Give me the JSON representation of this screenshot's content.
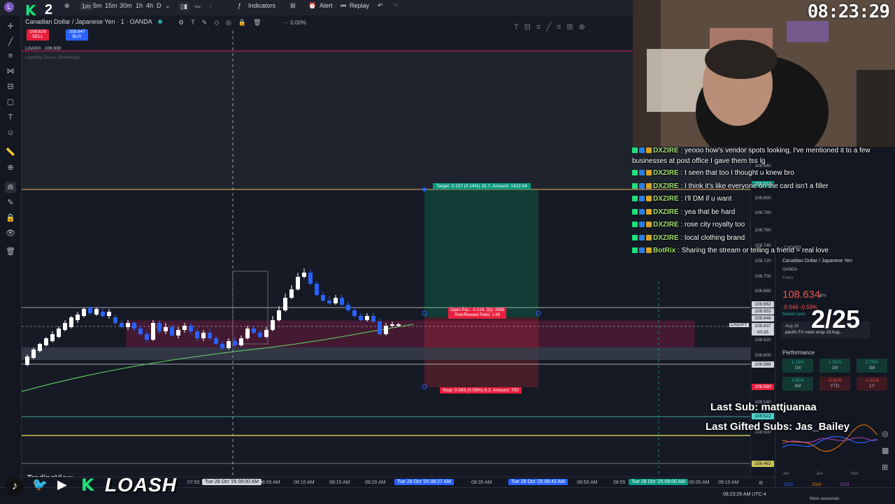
{
  "toolbar": {
    "timeframes": [
      "1m",
      "5m",
      "15m",
      "30m",
      "1h",
      "4h",
      "D"
    ],
    "active_timeframe": "1m",
    "indicators_label": "Indicators",
    "alert_label": "Alert",
    "replay_label": "Replay"
  },
  "symbol": {
    "name": "Canadian Dollar / Japanese Yen · 1 · OANDA",
    "change_pct": "0.00%",
    "sell_price": "108.629",
    "sell_label": "SELL",
    "buy_price": "108.647",
    "buy_label": "BUY",
    "loash_label": "LOASH · 108.630",
    "indicator_label": "Liquidity Zones (Sinbeluga)"
  },
  "position": {
    "target_label": "Target: 0.157 (0.14%) 15.7, Amount: 1422.04",
    "open_label": "Open P&L: -0.016, Qty: 2688",
    "rr_label": "Risk/Reward Ratio: 1.69",
    "stop_label": "Stop: 0.093 (0.09%) 9.3, Amount: 750"
  },
  "price_axis": {
    "labels": [
      "108.840",
      "108.800",
      "108.780",
      "108.760",
      "108.740",
      "108.720",
      "108.700",
      "108.680",
      "108.660",
      "108.620",
      "108.600",
      "108.580",
      "108.540",
      "108.520",
      "108.500",
      "108.480"
    ],
    "tags": {
      "top": "108.812",
      "current_a": "108.662",
      "current_b": "108.653",
      "current_c": "108.648",
      "symbol": "CADJPY",
      "last": "108.637",
      "countdown": "00:35",
      "low": "108.588",
      "stop": "108.560",
      "bottom_line": "108.522",
      "yellow": "108.462"
    }
  },
  "time_axis": {
    "labels": [
      "07:55",
      "08:05 AM",
      "08:10 AM",
      "08:15 AM",
      "08:20 AM",
      "08:35 AM",
      "08:50 AM",
      "08:55",
      "09:05 AM",
      "09:10 AM"
    ],
    "tag_a": "Tue 28 Oct '25 08:00 AM",
    "tag_b": "Tue 28 Oct '25 08:27 AM",
    "tag_c": "Tue 28 Oct '25 08:43 AM",
    "tag_d": "Tue 28 Oct '25 09:00 AM",
    "status": "08:23:26 AM UTC-4",
    "watermark": "TradingView"
  },
  "stream": {
    "clock": "08:23:29",
    "counter": "2/25",
    "last_sub": "Last Sub: mattjuanaa",
    "last_gifted": "Last Gifted Subs: Jas_Bailey",
    "brand": "LOASH",
    "k2": "2"
  },
  "chat": [
    {
      "user": "DXZIRE",
      "text": " : yeooo how's vendor spots looking, I've mentioned it to a few businesses at post office I gave them tss lg"
    },
    {
      "user": "DXZIRE",
      "text": " : I seen that too I thought u knew bro"
    },
    {
      "user": "DXZIRE",
      "text": " : I think it's like everyone on the card isn't a filler"
    },
    {
      "user": "DXZIRE",
      "text": " : I'll DM if u want"
    },
    {
      "user": "DXZIRE",
      "text": " : yea that be hard"
    },
    {
      "user": "DXZIRE",
      "text": " : rose city royalty too"
    },
    {
      "user": "DXZIRE",
      "text": " : local clothing brand"
    },
    {
      "user": "BotRix",
      "text": " : Sharing the stream or telling a friend = real love"
    }
  ],
  "panel": {
    "symbol_code": "CADJPY",
    "title": "Canadian Dollar / Japanese Yen",
    "exchange": "OANDA",
    "type": "Forex",
    "price": "108.634",
    "currency": "JPY",
    "change": "-0.646  -0.59%",
    "market": "Market open",
    "news_date": "Aug 18",
    "news_text": "pacific FX news wrap 19 Aug...",
    "performance_label": "Performance",
    "perf": [
      {
        "v": "1.19%",
        "p": "1W",
        "c": "#26a69a"
      },
      {
        "v": "1.01%",
        "p": "1M",
        "c": "#26a69a"
      },
      {
        "v": "0.75%",
        "p": "3M",
        "c": "#26a69a"
      },
      {
        "v": "4.80%",
        "p": "6M",
        "c": "#26a69a"
      },
      {
        "v": "-0.62%",
        "p": "YTD",
        "c": "#ef5350"
      },
      {
        "v": "-1.51%",
        "p": "1Y",
        "c": "#ef5350"
      }
    ],
    "seasonals_x": [
      "Jan",
      "Jun",
      "Nov"
    ],
    "legend": [
      "2025",
      "2024",
      "2023"
    ],
    "more": "More seasonals"
  },
  "colors": {
    "up": "#ffffff",
    "down": "#2962ff",
    "target_zone": "#0d3b33",
    "stop_zone": "#4a1c24",
    "accent_green": "#1de27a"
  }
}
